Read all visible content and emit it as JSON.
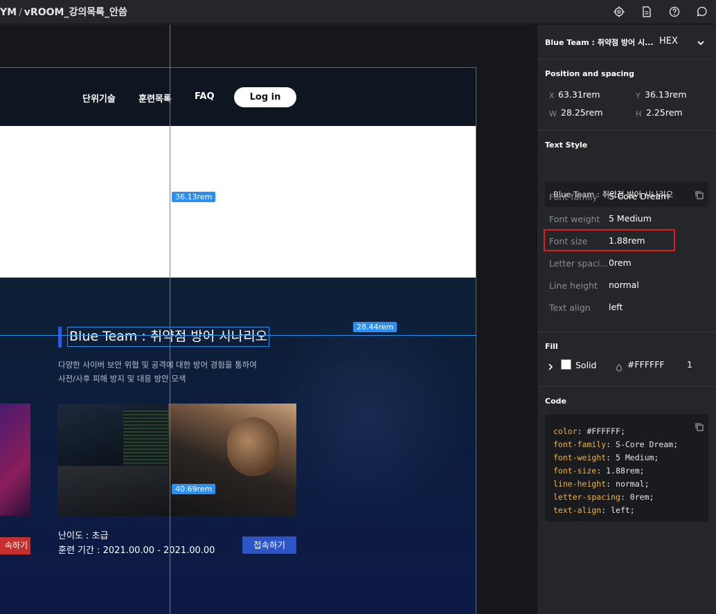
{
  "topbar": {
    "breadcrumb_left": "YM",
    "separator": "/",
    "breadcrumb_right": "vROOM_강의목록_안씀",
    "icons": [
      "settings-icon",
      "document-icon",
      "help-icon",
      "comment-icon"
    ]
  },
  "site": {
    "nav": [
      "단위기술",
      "훈련목록",
      "FAQ"
    ],
    "login_label": "Log in",
    "section_title": "Blue Team : 취약점 방어 시나리오",
    "section_desc_1": "다양한 사이버 보안 위협 및 공격에 대한 방어 경험을 통하여",
    "section_desc_2": "사전/사후 피해 방지 및 대응 방안 모색",
    "left_card_button": "속하기",
    "card_level": "난이도 : 초급",
    "card_period": "훈련 기간 : 2021.00.00 - 2021.00.00",
    "card_button": "접속하기"
  },
  "measure": {
    "vertical_label": "36.13rem",
    "horizontal_label": "28.44rem",
    "bottom_label": "40.69rem"
  },
  "panel": {
    "layer_name": "Blue Team : 취약점 방어 시...",
    "color_mode": "HEX",
    "position_header": "Position and spacing",
    "x_label": "X",
    "x_value": "63.31rem",
    "y_label": "Y",
    "y_value": "36.13rem",
    "w_label": "W",
    "w_value": "28.25rem",
    "h_label": "H",
    "h_value": "2.25rem",
    "text_style_header": "Text Style",
    "sample_text": "Blue Team : 취약점 방어 시나리오",
    "props": [
      {
        "label": "Font family",
        "value": "S-Core Dream"
      },
      {
        "label": "Font weight",
        "value": "5 Medium"
      },
      {
        "label": "Font size",
        "value": "1.88rem"
      },
      {
        "label": "Letter spaci...",
        "value": "0rem"
      },
      {
        "label": "Line height",
        "value": "normal"
      },
      {
        "label": "Text align",
        "value": "left"
      }
    ],
    "fill_header": "Fill",
    "fill_type": "Solid",
    "fill_hex": "#FFFFFF",
    "fill_opacity": "1",
    "code_header": "Code",
    "code": [
      {
        "k": "color",
        "v": " #FFFFFF;"
      },
      {
        "k": "font-family",
        "v": " S-Core Dream;"
      },
      {
        "k": "font-weight",
        "v": " 5 Medium;"
      },
      {
        "k": "font-size",
        "v": " 1.88rem;"
      },
      {
        "k": "line-height",
        "v": " normal;"
      },
      {
        "k": "letter-spacing",
        "v": " 0rem;"
      },
      {
        "k": "text-align",
        "v": " left;"
      }
    ]
  },
  "colors": {
    "accent": "#2b8ef0",
    "highlight": "#e21c1c",
    "code_key": "#f2b340",
    "primary_button": "#2b55c9",
    "danger_button": "#c72f2f"
  }
}
